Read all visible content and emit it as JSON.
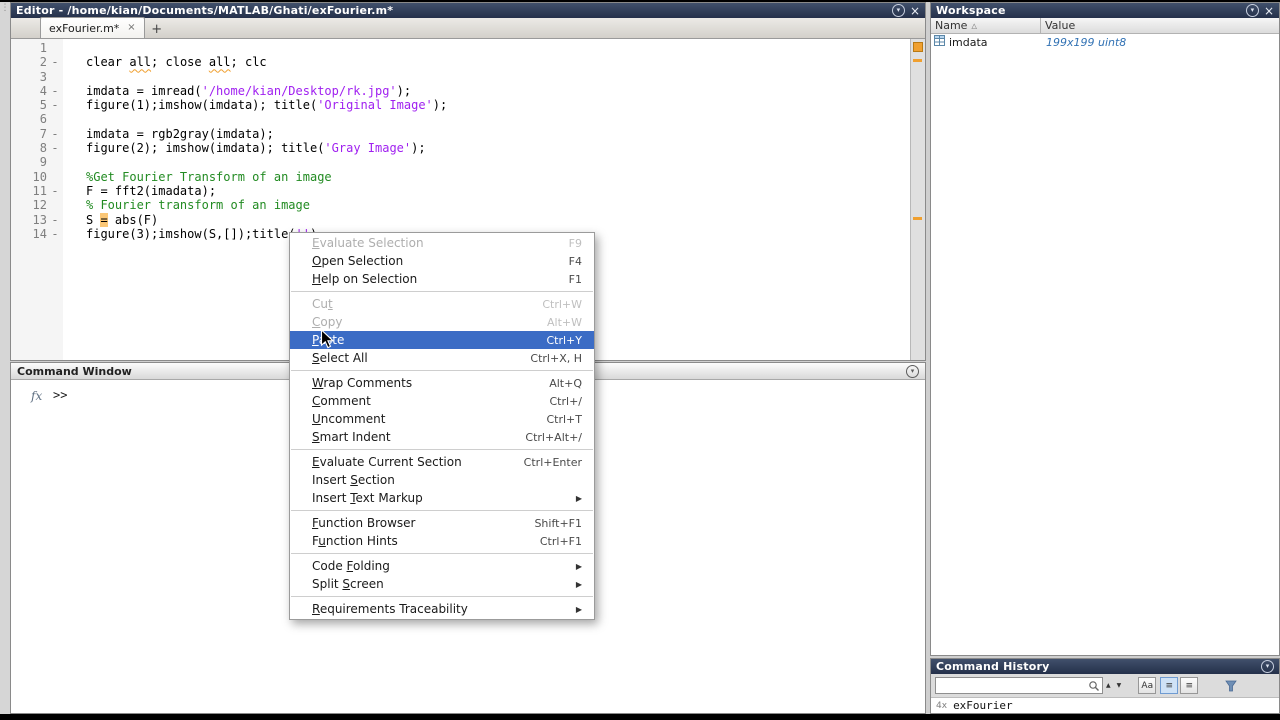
{
  "colors": {
    "titlebar_bg": "#24304a",
    "selection_blue": "#3b6cc5",
    "comment_green": "#228b22",
    "string_purple": "#a020f0",
    "warning_orange": "#f0a030",
    "value_blue": "#3272b4"
  },
  "glyphs": {
    "close": "×",
    "panel_menu": "▾",
    "submenu_arrow": "▶",
    "sort": "△",
    "up": "▲",
    "down": "▼",
    "list": "≡",
    "grip": "⋮",
    "plus": "+"
  },
  "titlebar": {
    "title": "Editor - /home/kian/Documents/MATLAB/Ghati/exFourier.m*"
  },
  "editor": {
    "tab_label": "exFourier.m*",
    "lint_lines": [
      2,
      13
    ],
    "lines": [
      {
        "n": "1",
        "d": false,
        "seg": []
      },
      {
        "n": "2",
        "d": true,
        "seg": [
          {
            "t": "clear ",
            "y": "p"
          },
          {
            "t": "all",
            "y": "w"
          },
          {
            "t": "; close ",
            "y": "p"
          },
          {
            "t": "all",
            "y": "w"
          },
          {
            "t": "; clc",
            "y": "p"
          }
        ]
      },
      {
        "n": "3",
        "d": false,
        "seg": []
      },
      {
        "n": "4",
        "d": true,
        "seg": [
          {
            "t": "imdata = imread(",
            "y": "p"
          },
          {
            "t": "'/home/kian/Desktop/rk.jpg'",
            "y": "s"
          },
          {
            "t": ");",
            "y": "p"
          }
        ]
      },
      {
        "n": "5",
        "d": true,
        "seg": [
          {
            "t": "figure(1);imshow(imdata); title(",
            "y": "p"
          },
          {
            "t": "'Original Image'",
            "y": "s"
          },
          {
            "t": ");",
            "y": "p"
          }
        ]
      },
      {
        "n": "6",
        "d": false,
        "seg": []
      },
      {
        "n": "7",
        "d": true,
        "seg": [
          {
            "t": "imdata = rgb2gray(imdata);",
            "y": "p"
          }
        ]
      },
      {
        "n": "8",
        "d": true,
        "seg": [
          {
            "t": "figure(2); imshow(imdata); title(",
            "y": "p"
          },
          {
            "t": "'Gray Image'",
            "y": "s"
          },
          {
            "t": ");",
            "y": "p"
          }
        ]
      },
      {
        "n": "9",
        "d": false,
        "seg": []
      },
      {
        "n": "10",
        "d": false,
        "seg": [
          {
            "t": "%Get Fourier Transform of an image",
            "y": "c"
          }
        ]
      },
      {
        "n": "11",
        "d": true,
        "seg": [
          {
            "t": "F = fft2(imadata);",
            "y": "p"
          }
        ]
      },
      {
        "n": "12",
        "d": false,
        "seg": [
          {
            "t": "% Fourier transform of an image",
            "y": "c"
          }
        ]
      },
      {
        "n": "13",
        "d": true,
        "seg": [
          {
            "t": "S ",
            "y": "p"
          },
          {
            "t": "=",
            "y": "b"
          },
          {
            "t": " abs(F)",
            "y": "p"
          }
        ]
      },
      {
        "n": "14",
        "d": true,
        "seg": [
          {
            "t": "figure(3);imshow(S,[]);title(",
            "y": "p"
          },
          {
            "t": "''",
            "y": "s"
          },
          {
            "t": ")",
            "y": "p"
          }
        ]
      }
    ]
  },
  "menu": {
    "items": [
      {
        "label": "Evaluate Selection",
        "shortcut": "F9",
        "state": "disabled",
        "u": 0
      },
      {
        "label": "Open Selection",
        "shortcut": "F4",
        "u": 0
      },
      {
        "label": "Help on Selection",
        "shortcut": "F1",
        "u": 0
      },
      {
        "sep": true
      },
      {
        "label": "Cut",
        "shortcut": "Ctrl+W",
        "state": "disabled",
        "u": 2
      },
      {
        "label": "Copy",
        "shortcut": "Alt+W",
        "state": "disabled",
        "u": 0
      },
      {
        "label": "Paste",
        "shortcut": "Ctrl+Y",
        "state": "highlight",
        "u": 0
      },
      {
        "label": "Select All",
        "shortcut": "Ctrl+X, H",
        "u": 0
      },
      {
        "sep": true
      },
      {
        "label": "Wrap Comments",
        "shortcut": "Alt+Q",
        "u": 0
      },
      {
        "label": "Comment",
        "shortcut": "Ctrl+/",
        "u": 0
      },
      {
        "label": "Uncomment",
        "shortcut": "Ctrl+T",
        "u": 0
      },
      {
        "label": "Smart Indent",
        "shortcut": "Ctrl+Alt+/",
        "u": 0
      },
      {
        "sep": true
      },
      {
        "label": "Evaluate Current Section",
        "shortcut": "Ctrl+Enter",
        "u": 0
      },
      {
        "label": "Insert Section",
        "u": 7
      },
      {
        "label": "Insert Text Markup",
        "submenu": true,
        "u": 7
      },
      {
        "sep": true
      },
      {
        "label": "Function Browser",
        "shortcut": "Shift+F1",
        "u": 0
      },
      {
        "label": "Function Hints",
        "shortcut": "Ctrl+F1",
        "u": 1
      },
      {
        "sep": true
      },
      {
        "label": "Code Folding",
        "submenu": true,
        "u": 5
      },
      {
        "label": "Split Screen",
        "submenu": true,
        "u": 6
      },
      {
        "sep": true
      },
      {
        "label": "Requirements Traceability",
        "submenu": true,
        "u": 0
      }
    ]
  },
  "command_window": {
    "title": "Command Window",
    "fx": "fx",
    "prompt": ">>"
  },
  "workspace": {
    "title": "Workspace",
    "col_name": "Name",
    "col_value": "Value",
    "rows": [
      {
        "name": "imdata",
        "value": "199x199 uint8"
      }
    ]
  },
  "history": {
    "title": "Command History",
    "search_value": "",
    "aa_label": "Aa",
    "entries": [
      {
        "count": "4x",
        "text": "exFourier"
      }
    ]
  }
}
